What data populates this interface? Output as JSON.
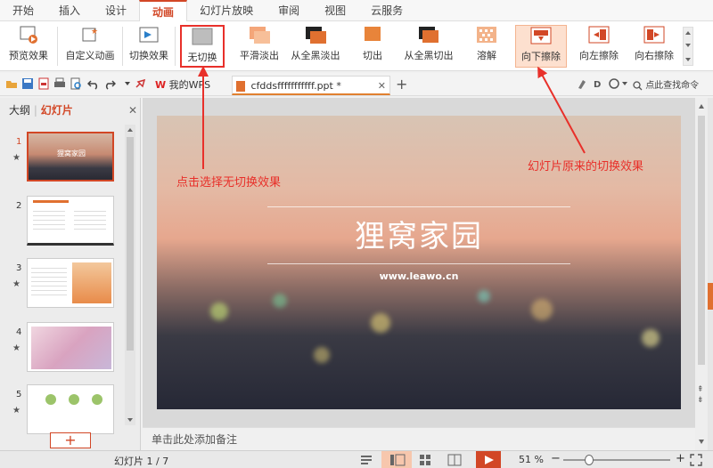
{
  "menu": {
    "tabs": [
      "开始",
      "插入",
      "设计",
      "动画",
      "幻灯片放映",
      "审阅",
      "视图",
      "云服务"
    ],
    "active": "动画"
  },
  "ribbon": {
    "preview": "预览效果",
    "custom": "自定义动画",
    "switch": "切换效果",
    "none": "无切换",
    "smooth": "平滑淡出",
    "black_fade": "从全黑淡出",
    "cut": "切出",
    "black_cut": "从全黑切出",
    "dissolve": "溶解",
    "wipe_down": "向下擦除",
    "wipe_left": "向左擦除",
    "wipe_right": "向右擦除"
  },
  "tabs": {
    "home_tab": "我的WPS",
    "doc_tab": "cfddsfffffffffff.ppt *",
    "search": "点此查找命令"
  },
  "left_panel": {
    "outline": "大纲",
    "slides": "幻灯片",
    "thumbs": [
      "1",
      "2",
      "3",
      "4",
      "5"
    ],
    "thumb1_text": "狸窝家园",
    "add": "+"
  },
  "slide": {
    "title": "狸窝家园",
    "url": "www.leawo.cn"
  },
  "notes_placeholder": "单击此处添加备注",
  "status": {
    "slide_counter": "幻灯片 1 / 7",
    "zoom": "51 %"
  },
  "annotations": {
    "left": "点击选择无切换效果",
    "right": "幻灯片原来的切换效果"
  },
  "colors": {
    "accent": "#d24726",
    "annotation": "#e8302a",
    "selected_bg": "#fde0cf"
  }
}
